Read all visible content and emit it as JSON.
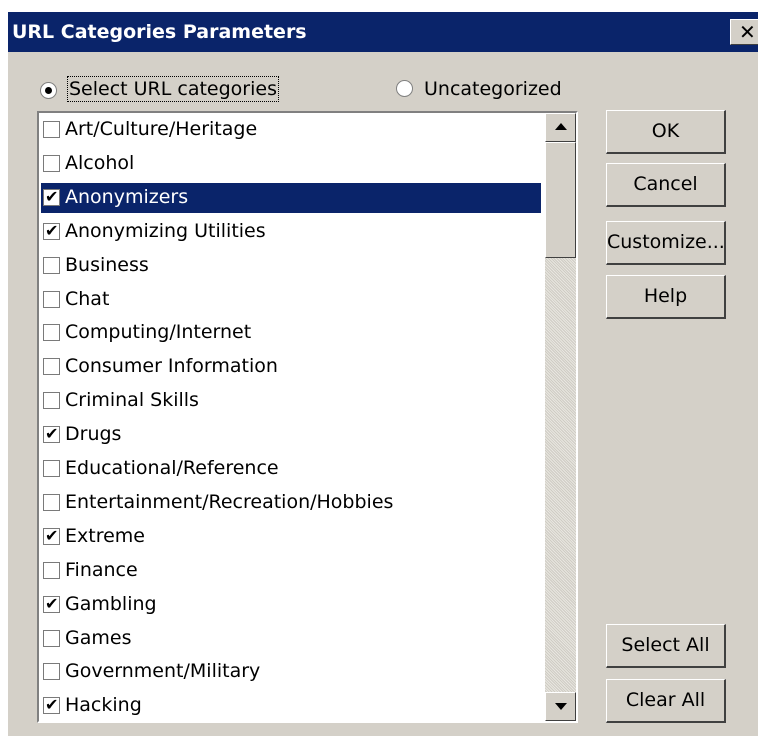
{
  "window": {
    "title": "URL Categories Parameters",
    "close_glyph": "✕"
  },
  "mode": {
    "select_label": "Select URL categories",
    "uncategorized_label": "Uncategorized",
    "selected": "select"
  },
  "categories": [
    {
      "label": "Art/Culture/Heritage",
      "checked": false,
      "selected": false
    },
    {
      "label": "Alcohol",
      "checked": false,
      "selected": false
    },
    {
      "label": "Anonymizers",
      "checked": true,
      "selected": true
    },
    {
      "label": "Anonymizing Utilities",
      "checked": true,
      "selected": false
    },
    {
      "label": "Business",
      "checked": false,
      "selected": false
    },
    {
      "label": "Chat",
      "checked": false,
      "selected": false
    },
    {
      "label": "Computing/Internet",
      "checked": false,
      "selected": false
    },
    {
      "label": "Consumer Information",
      "checked": false,
      "selected": false
    },
    {
      "label": "Criminal Skills",
      "checked": false,
      "selected": false
    },
    {
      "label": "Drugs",
      "checked": true,
      "selected": false
    },
    {
      "label": "Educational/Reference",
      "checked": false,
      "selected": false
    },
    {
      "label": "Entertainment/Recreation/Hobbies",
      "checked": false,
      "selected": false
    },
    {
      "label": "Extreme",
      "checked": true,
      "selected": false
    },
    {
      "label": "Finance",
      "checked": false,
      "selected": false
    },
    {
      "label": "Gambling",
      "checked": true,
      "selected": false
    },
    {
      "label": "Games",
      "checked": false,
      "selected": false
    },
    {
      "label": "Government/Military",
      "checked": false,
      "selected": false
    },
    {
      "label": "Hacking",
      "checked": true,
      "selected": false
    }
  ],
  "buttons": {
    "ok": "OK",
    "cancel": "Cancel",
    "customize": "Customize...",
    "help": "Help",
    "select_all": "Select All",
    "clear_all": "Clear All"
  },
  "colors": {
    "highlight": "#0a246a",
    "face": "#d4d0c8"
  }
}
